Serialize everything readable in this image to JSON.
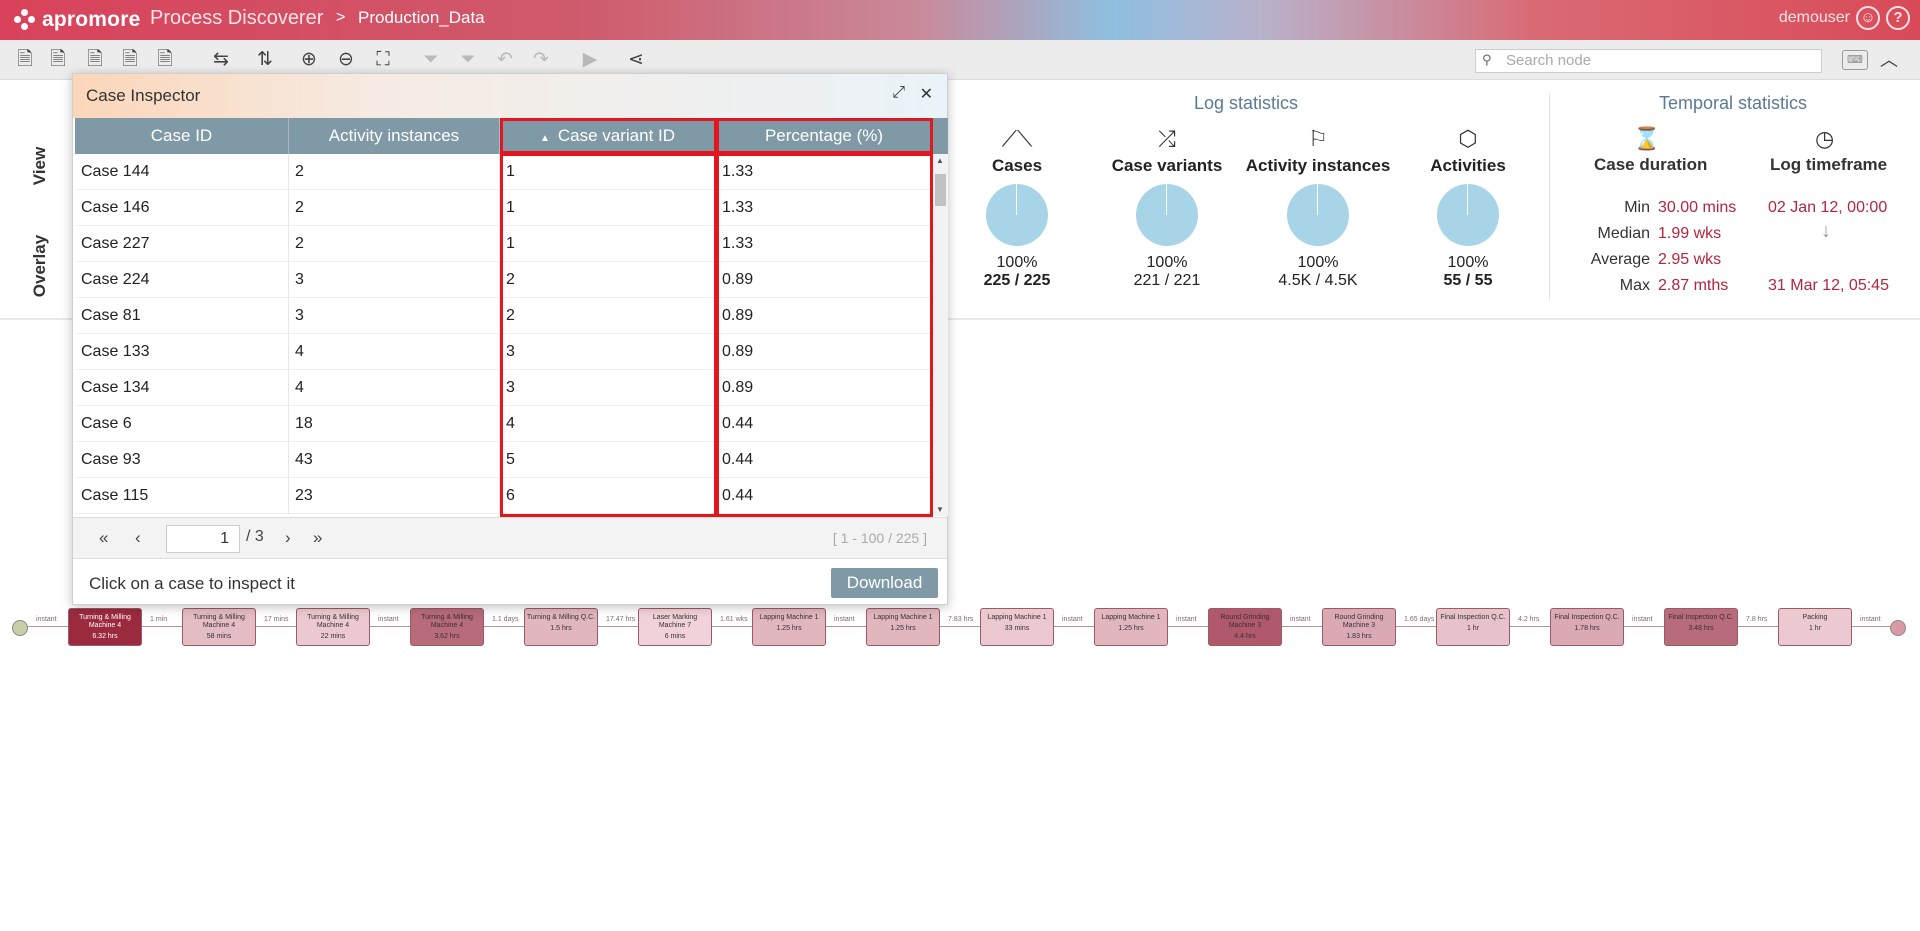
{
  "header": {
    "logo": "apromore",
    "app_name": "Process Discoverer",
    "separator": ">",
    "log_name": "Production_Data",
    "user": "demouser"
  },
  "toolbar": {
    "search_placeholder": "Search node"
  },
  "side_tabs": {
    "view": "View",
    "overlay": "Overlay"
  },
  "log_statistics": {
    "title": "Log statistics",
    "items": [
      {
        "icon": "road-icon",
        "label": "Cases",
        "percent": "100%",
        "count": "225 / 225",
        "bold": true
      },
      {
        "icon": "shuffle-icon",
        "label": "Case variants",
        "percent": "100%",
        "count": "221 / 221",
        "bold": false
      },
      {
        "icon": "flag-icon",
        "label": "Activity instances",
        "percent": "100%",
        "count": "4.5K / 4.5K",
        "bold": false
      },
      {
        "icon": "cube-icon",
        "label": "Activities",
        "percent": "100%",
        "count": "55 / 55",
        "bold": true
      }
    ]
  },
  "temporal_statistics": {
    "title": "Temporal statistics",
    "case_duration_label": "Case duration",
    "log_timeframe_label": "Log timeframe",
    "durations": [
      {
        "key": "Min",
        "value": "30.00 mins"
      },
      {
        "key": "Median",
        "value": "1.99 wks"
      },
      {
        "key": "Average",
        "value": "2.95 wks"
      },
      {
        "key": "Max",
        "value": "2.87 mths"
      }
    ],
    "start": "02 Jan 12, 00:00",
    "end": "31 Mar 12, 05:45"
  },
  "case_inspector": {
    "title": "Case Inspector",
    "columns": [
      "Case ID",
      "Activity instances",
      "Case variant ID",
      "Percentage (%)"
    ],
    "rows": [
      [
        "Case 144",
        "2",
        "1",
        "1.33"
      ],
      [
        "Case 146",
        "2",
        "1",
        "1.33"
      ],
      [
        "Case 227",
        "2",
        "1",
        "1.33"
      ],
      [
        "Case 224",
        "3",
        "2",
        "0.89"
      ],
      [
        "Case 81",
        "3",
        "2",
        "0.89"
      ],
      [
        "Case 133",
        "4",
        "3",
        "0.89"
      ],
      [
        "Case 134",
        "4",
        "3",
        "0.89"
      ],
      [
        "Case 6",
        "18",
        "4",
        "0.44"
      ],
      [
        "Case 93",
        "43",
        "5",
        "0.44"
      ],
      [
        "Case 115",
        "23",
        "6",
        "0.44"
      ]
    ],
    "page": "1",
    "page_total": "/ 3",
    "range": "[ 1 - 100 / 225 ]",
    "hint": "Click on a case to inspect it",
    "download": "Download"
  },
  "process_map": {
    "nodes": [
      {
        "name": "Turning & Milling Machine 4",
        "dur": "6.32 hrs",
        "color": "#9b2a3e",
        "dark": true
      },
      {
        "name": "Turning & Milling Machine 4",
        "dur": "58 mins",
        "color": "#e3bcc4",
        "dark": false
      },
      {
        "name": "Turning & Milling Machine 4",
        "dur": "22 mins",
        "color": "#ecc9d0",
        "dark": false
      },
      {
        "name": "Turning & Milling Machine 4",
        "dur": "3.62 hrs",
        "color": "#b86b7a",
        "dark": false
      },
      {
        "name": "Turning & Milling Q.C.",
        "dur": "1.5 hrs",
        "color": "#e1b6bf",
        "dark": false
      },
      {
        "name": "Laser Marking Machine 7",
        "dur": "6 mins",
        "color": "#f0d2d8",
        "dark": false
      },
      {
        "name": "Lapping Machine 1",
        "dur": "1.25 hrs",
        "color": "#e1b6bf",
        "dark": false
      },
      {
        "name": "Lapping Machine 1",
        "dur": "1.25 hrs",
        "color": "#e1b6bf",
        "dark": false
      },
      {
        "name": "Lapping Machine 1",
        "dur": "33 mins",
        "color": "#ecc9d0",
        "dark": false
      },
      {
        "name": "Lapping Machine 1",
        "dur": "1.25 hrs",
        "color": "#e1b6bf",
        "dark": false
      },
      {
        "name": "Round Grinding Machine 3",
        "dur": "4.4 hrs",
        "color": "#b0596b",
        "dark": false
      },
      {
        "name": "Round Grinding Machine 3",
        "dur": "1.83 hrs",
        "color": "#dba9b4",
        "dark": false
      },
      {
        "name": "Final Inspection Q.C.",
        "dur": "1 hr",
        "color": "#e8c2ca",
        "dark": false
      },
      {
        "name": "Final Inspection Q.C.",
        "dur": "1.78 hrs",
        "color": "#dba9b4",
        "dark": false
      },
      {
        "name": "Final Inspection Q.C.",
        "dur": "3.48 hrs",
        "color": "#b86b7a",
        "dark": false
      },
      {
        "name": "Packing",
        "dur": "1 hr",
        "color": "#ecc9d0",
        "dark": false
      }
    ],
    "edges": [
      "instant",
      "1 min",
      "17 mins",
      "instant",
      "1.1 days",
      "17.47 hrs",
      "1.61 wks",
      "instant",
      "7.83 hrs",
      "instant",
      "instant",
      "instant",
      "1.65 days",
      "4.2 hrs",
      "instant",
      "7.8 hrs",
      "instant"
    ]
  }
}
